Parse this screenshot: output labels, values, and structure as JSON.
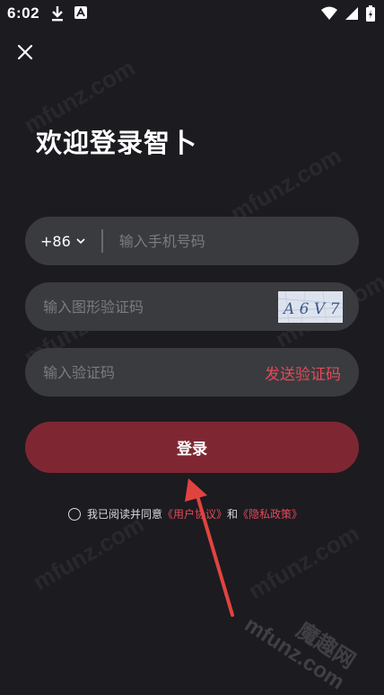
{
  "status_bar": {
    "time": "6:02",
    "left_icons": [
      "download-icon",
      "app-notification-icon"
    ],
    "right_icons": [
      "wifi-icon",
      "signal-icon",
      "battery-icon"
    ]
  },
  "header": {
    "close_icon": "close-icon",
    "title": "欢迎登录智卜"
  },
  "phone": {
    "country_code": "+86",
    "placeholder": "输入手机号码"
  },
  "captcha": {
    "placeholder": "输入图形验证码",
    "image_text": "A 6 V 7"
  },
  "sms": {
    "placeholder": "输入验证码",
    "send_label": "发送验证码"
  },
  "login": {
    "label": "登录"
  },
  "agreement": {
    "prefix": "我已阅读并同意",
    "user_agreement": "《用户协议》",
    "and": "和",
    "privacy_policy": "《隐私政策》"
  },
  "watermark": {
    "site": "mfunz.com",
    "brand": "魔趣网"
  },
  "colors": {
    "background": "#1c1b20",
    "field": "#3a3b3f",
    "accent": "#e44a57",
    "button": "#7e2732"
  }
}
